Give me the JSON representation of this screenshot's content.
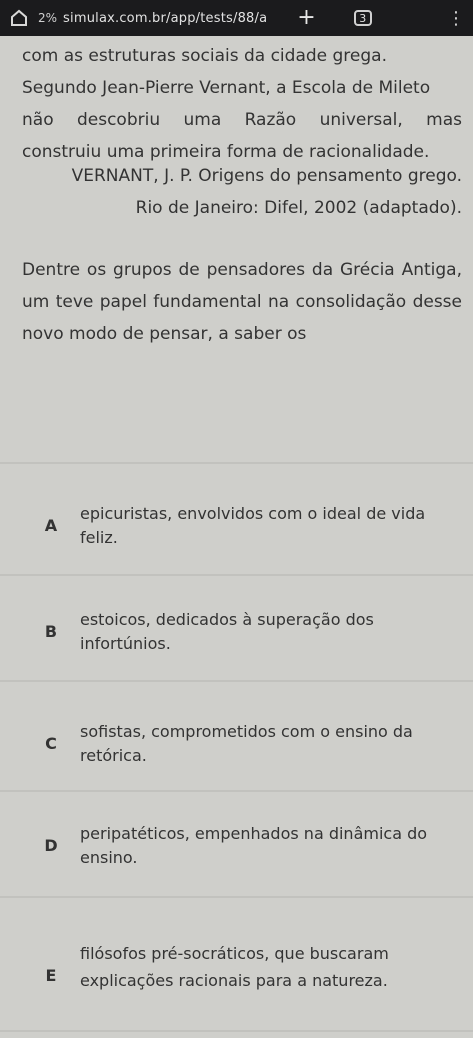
{
  "browser": {
    "zoom": "2%",
    "url": "simulax.com.br/app/tests/88/a",
    "tab_count": "3"
  },
  "passage": {
    "line1": "com as estruturas sociais da cidade grega.",
    "line2": "Segundo Jean-Pierre Vernant, a Escola de Mileto",
    "line3": "não descobriu uma Razão universal, mas",
    "line4": "construiu uma primeira forma de racionalidade."
  },
  "citation": {
    "line1": "VERNANT, J. P. Origens do pensamento grego.",
    "line2": "Rio de Janeiro: Difel, 2002 (adaptado)."
  },
  "question": {
    "text": "Dentre os grupos de pensadores da Grécia Antiga, um teve papel fundamental na consolidação desse novo modo de pensar, a saber os"
  },
  "options": [
    {
      "letter": "A",
      "text": "epicuristas, envolvidos com o ideal de vida feliz."
    },
    {
      "letter": "B",
      "text": "estoicos, dedicados à superação dos infortúnios."
    },
    {
      "letter": "C",
      "text": "sofistas, comprometidos com o ensino da retórica."
    },
    {
      "letter": "D",
      "text": "peripatéticos, empenhados na dinâmica do ensino."
    },
    {
      "letter": "E",
      "text": "filósofos pré-socráticos, que buscaram explicações racionais para a natureza."
    }
  ]
}
